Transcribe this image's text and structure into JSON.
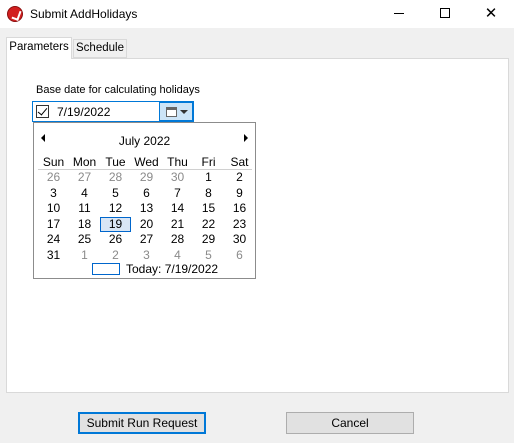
{
  "window": {
    "title": "Submit AddHolidays",
    "minimize_glyph": "minimize-icon",
    "maximize_glyph": "maximize-icon",
    "close_glyph": "✕"
  },
  "tabs": [
    {
      "label": "Parameters",
      "selected": true
    },
    {
      "label": "Schedule",
      "selected": false
    }
  ],
  "parameters": {
    "base_date_label": "Base date for calculating holidays",
    "date_value": "7/19/2022",
    "date_checked": true
  },
  "calendar": {
    "month_title": "July 2022",
    "days_of_week": [
      "Sun",
      "Mon",
      "Tue",
      "Wed",
      "Thu",
      "Fri",
      "Sat"
    ],
    "weeks": [
      [
        "26",
        "27",
        "28",
        "29",
        "30",
        "1",
        "2"
      ],
      [
        "3",
        "4",
        "5",
        "6",
        "7",
        "8",
        "9"
      ],
      [
        "10",
        "11",
        "12",
        "13",
        "14",
        "15",
        "16"
      ],
      [
        "17",
        "18",
        "19",
        "20",
        "21",
        "22",
        "23"
      ],
      [
        "24",
        "25",
        "26",
        "27",
        "28",
        "29",
        "30"
      ],
      [
        "31",
        "1",
        "2",
        "3",
        "4",
        "5",
        "6"
      ]
    ],
    "selected_day": "19",
    "today_label": "Today: 7/19/2022"
  },
  "buttons": {
    "submit": "Submit Run Request",
    "cancel": "Cancel"
  },
  "colors": {
    "accent": "#0078d7",
    "app_icon": "#d21f1f"
  }
}
